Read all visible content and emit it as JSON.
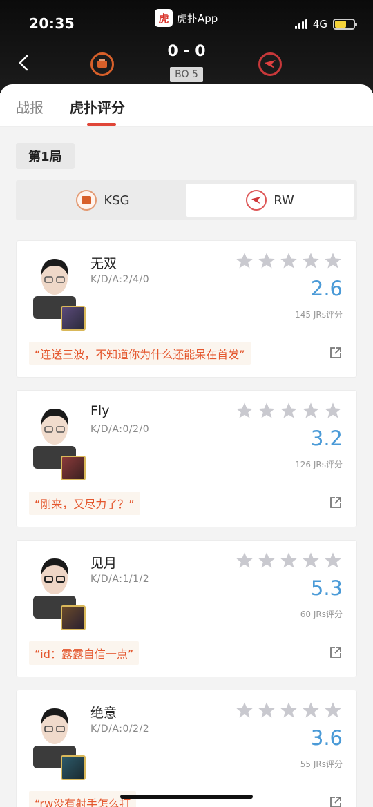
{
  "status": {
    "time": "20:35",
    "network": "4G"
  },
  "app": {
    "title": "虎扑App",
    "logo_text": "虎"
  },
  "match": {
    "score": "0 - 0",
    "format": "BO 5"
  },
  "tabs": [
    {
      "label": "战报"
    },
    {
      "label": "虎扑评分"
    }
  ],
  "game": {
    "label": "第1局"
  },
  "teams": [
    {
      "name": "KSG"
    },
    {
      "name": "RW"
    }
  ],
  "colors": {
    "accent": "#e04638",
    "score": "#4a9ad7",
    "comment": "#e4572e"
  },
  "players": [
    {
      "name": "无双",
      "kda": "K/D/A:2/4/0",
      "score": "2.6",
      "count": "145 JRs评分",
      "comment": "“连送三波，不知道你为什么还能呆在首发”",
      "hero_color": "#5b4a7a"
    },
    {
      "name": "Fly",
      "kda": "K/D/A:0/2/0",
      "score": "3.2",
      "count": "126 JRs评分",
      "comment": "“刚来，又尽力了？”",
      "hero_color": "#8a3a3a"
    },
    {
      "name": "见月",
      "kda": "K/D/A:1/1/2",
      "score": "5.3",
      "count": "60 JRs评分",
      "comment": "“id：露露自信一点”",
      "hero_color": "#6a4a2a"
    },
    {
      "name": "绝意",
      "kda": "K/D/A:0/2/2",
      "score": "3.6",
      "count": "55 JRs评分",
      "comment": "“rw没有射手怎么打",
      "hero_color": "#2d5a6a"
    }
  ]
}
